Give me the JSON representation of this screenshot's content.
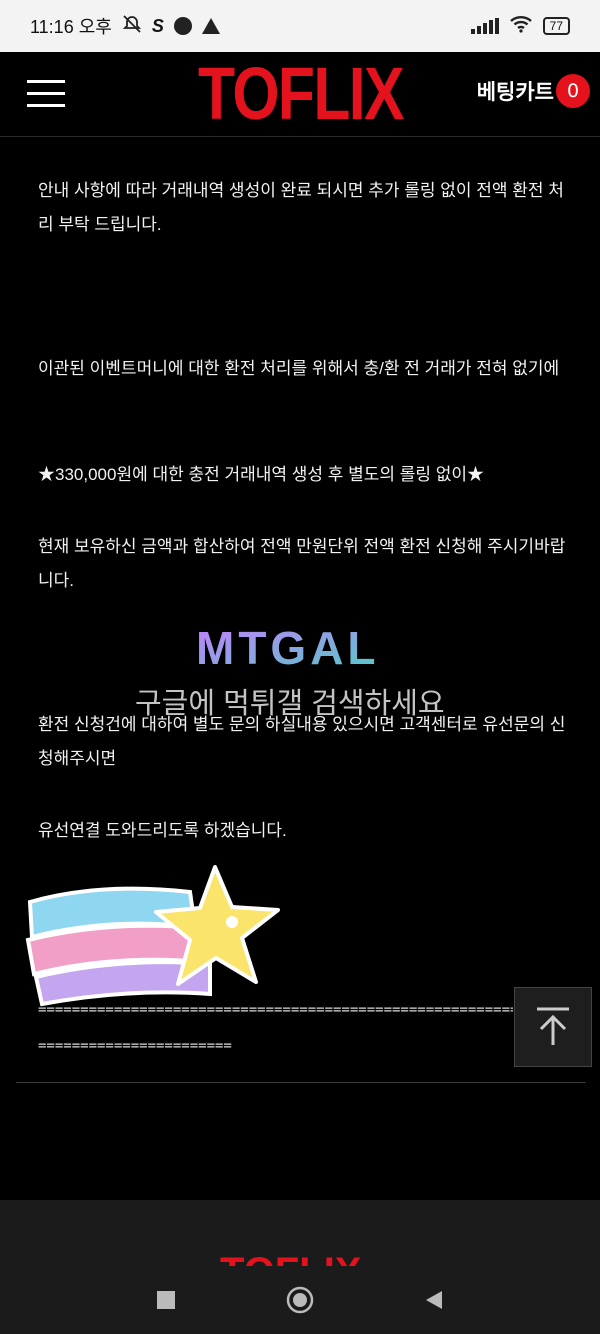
{
  "status_bar": {
    "time": "11:16 오후",
    "battery": "77"
  },
  "header": {
    "logo": "TOFLIX",
    "cart_label": "베팅카트",
    "cart_count": "0"
  },
  "article": {
    "p1": "안내 사항에 따라 거래내역 생성이 완료 되시면 추가 롤링 없이 전액 환전 처리 부탁 드립니다.",
    "p2": "이관된 이벤트머니에 대한 환전 처리를 위해서 충/환 전 거래가 전혀 없기에",
    "p3": "★330,000원에 대한 충전 거래내역 생성 후 별도의 롤링 없이★",
    "p4": "현재 보유하신 금액과 합산하여 전액 만원단위 전액 환전 신청해 주시기바랍니다.",
    "p5": "환전 신청건에 대하여 별도 문의 하실내용 있으시면 고객센터로 유선문의 신청해주시면",
    "p6": "유선연결 도와드리도록 하겠습니다.",
    "dashes_1": "------------------------------------------------------------",
    "dashes_2": "=======================",
    "dashes_1_display": "==========================================================="
  },
  "watermark": {
    "logo": "MTGAL",
    "text": "구글에 먹튀갤 검색하세요"
  },
  "footer": {
    "logo": "TOFLIX"
  },
  "colors": {
    "brand_red": "#e4121c",
    "background": "#000000"
  }
}
